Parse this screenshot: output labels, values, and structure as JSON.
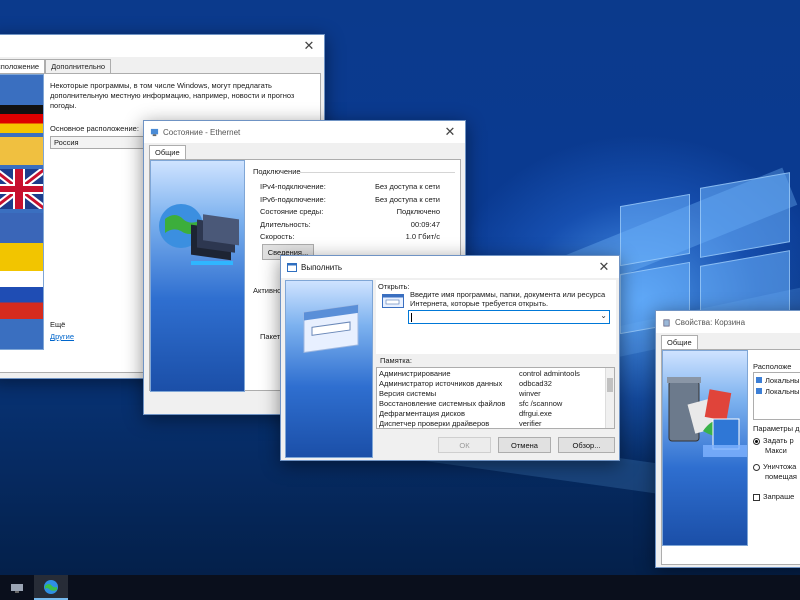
{
  "region_window": {
    "tabs": [
      "сположение",
      "Дополнительно"
    ],
    "description": "Некоторые программы, в том числе Windows, могут предлагать дополнительную местную информацию, например, новости и прогноз погоды.",
    "location_label": "Основное расположение:",
    "location_value": "Россия",
    "more_label": "Ещё",
    "others_link": "Другие"
  },
  "ethernet_window": {
    "title": "Состояние - Ethernet",
    "tab": "Общие",
    "connection_header": "Подключение",
    "rows": [
      {
        "label": "IPv4-подключение:",
        "value": "Без доступа к сети"
      },
      {
        "label": "IPv6-подключение:",
        "value": "Без доступа к сети"
      },
      {
        "label": "Состояние среды:",
        "value": "Подключено"
      },
      {
        "label": "Длительность:",
        "value": "00:09:47"
      },
      {
        "label": "Скорость:",
        "value": "1.0 Гбит/с"
      }
    ],
    "details_button": "Сведения...",
    "activity_label": "Активно",
    "packets_label": "Пакет"
  },
  "run_window": {
    "title": "Выполнить",
    "open_label": "Открыть:",
    "description": "Введите имя программы, папки, документа или ресурса Интернета, которые требуется открыть.",
    "input_value": "",
    "memo_label": "Памятка:",
    "memo_rows": [
      {
        "name": "Администрирование",
        "cmd": "control admintools"
      },
      {
        "name": "Администратор источников данных",
        "cmd": "odbcad32"
      },
      {
        "name": "Версия системы",
        "cmd": "winver"
      },
      {
        "name": "Восстановление системных файлов",
        "cmd": "sfc /scannow"
      },
      {
        "name": "Дефрагментация дисков",
        "cmd": "dfrgui.exe"
      },
      {
        "name": "Диспетчер проверки драйверов",
        "cmd": "verifier"
      }
    ],
    "ok_button": "ОК",
    "cancel_button": "Отмена",
    "browse_button": "Обзор..."
  },
  "recycle_window": {
    "title": "Свойства: Корзина",
    "tab": "Общие",
    "location_header": "Расположе",
    "locations": [
      "Локальны",
      "Локальны"
    ],
    "params_label": "Параметры д",
    "option_set_line1": "Задать р",
    "option_set_line2": "Макси",
    "option_delete_line1": "Уничтожа",
    "option_delete_line2": "помещая",
    "confirm_label": "Запраше"
  },
  "taskbar": {
    "items": [
      "network-app-icon",
      "globe-app-icon"
    ]
  },
  "colors": {
    "accent": "#0078d7",
    "link": "#0066cc",
    "desktop": "#0a3a92"
  }
}
